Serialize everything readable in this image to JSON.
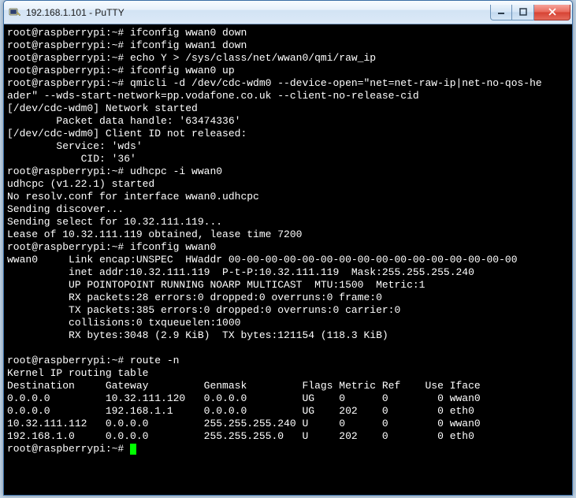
{
  "window": {
    "title": "192.168.1.101 - PuTTY"
  },
  "lines": [
    "root@raspberrypi:~# ifconfig wwan0 down",
    "root@raspberrypi:~# ifconfig wwan1 down",
    "root@raspberrypi:~# echo Y > /sys/class/net/wwan0/qmi/raw_ip",
    "root@raspberrypi:~# ifconfig wwan0 up",
    "root@raspberrypi:~# qmicli -d /dev/cdc-wdm0 --device-open=\"net=net-raw-ip|net-no-qos-he",
    "ader\" --wds-start-network=pp.vodafone.co.uk --client-no-release-cid",
    "[/dev/cdc-wdm0] Network started",
    "        Packet data handle: '63474336'",
    "[/dev/cdc-wdm0] Client ID not released:",
    "        Service: 'wds'",
    "            CID: '36'",
    "root@raspberrypi:~# udhcpc -i wwan0",
    "udhcpc (v1.22.1) started",
    "No resolv.conf for interface wwan0.udhcpc",
    "Sending discover...",
    "Sending select for 10.32.111.119...",
    "Lease of 10.32.111.119 obtained, lease time 7200",
    "root@raspberrypi:~# ifconfig wwan0",
    "wwan0     Link encap:UNSPEC  HWaddr 00-00-00-00-00-00-00-00-00-00-00-00-00-00-00-00",
    "          inet addr:10.32.111.119  P-t-P:10.32.111.119  Mask:255.255.255.240",
    "          UP POINTOPOINT RUNNING NOARP MULTICAST  MTU:1500  Metric:1",
    "          RX packets:28 errors:0 dropped:0 overruns:0 frame:0",
    "          TX packets:385 errors:0 dropped:0 overruns:0 carrier:0",
    "          collisions:0 txqueuelen:1000",
    "          RX bytes:3048 (2.9 KiB)  TX bytes:121154 (118.3 KiB)",
    "",
    "root@raspberrypi:~# route -n",
    "Kernel IP routing table",
    "Destination     Gateway         Genmask         Flags Metric Ref    Use Iface",
    "0.0.0.0         10.32.111.120   0.0.0.0         UG    0      0        0 wwan0",
    "0.0.0.0         192.168.1.1     0.0.0.0         UG    202    0        0 eth0",
    "10.32.111.112   0.0.0.0         255.255.255.240 U     0      0        0 wwan0",
    "192.168.1.0     0.0.0.0         255.255.255.0   U     202    0        0 eth0"
  ],
  "lastPrompt": "root@raspberrypi:~# "
}
